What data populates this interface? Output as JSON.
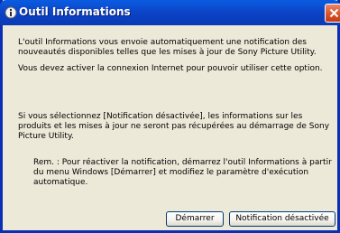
{
  "window": {
    "title": "Outil Informations",
    "title_icon": "info-icon",
    "close_icon": "close-icon"
  },
  "content": {
    "paragraph1": [
      "L'outil Informations vous envoie automatiquement une notification des",
      "nouveautés disponibles telles que les mises à jour de Sony Picture Utility."
    ],
    "paragraph2": [
      "Vous devez activer la connexion Internet pour pouvoir utiliser cette option."
    ],
    "paragraph3": [
      "Si vous sélectionnez [Notification désactivée], les informations sur les",
      "produits et les mises à jour ne seront pas récupérées au démarrage de Sony",
      "Picture Utility."
    ],
    "note": [
      "Rem. : Pour réactiver la notification, démarrez l'outil Informations à partir",
      "du menu Windows [Démarrer] et modifiez le paramètre d'exécution",
      "automatique."
    ]
  },
  "buttons": {
    "start_label": "Démarrer",
    "disable_label": "Notification désactivée"
  },
  "colors": {
    "titlebar": "#0a45c9",
    "dialog_background": "#ece9d8",
    "close_button": "#d9532c"
  }
}
